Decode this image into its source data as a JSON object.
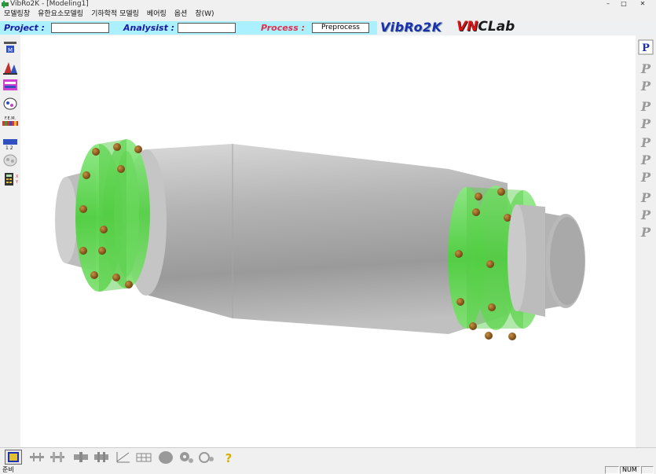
{
  "window": {
    "title": "VibRo2K - [Modeling1]"
  },
  "menu": [
    "모델링창",
    "유한요소모델링",
    "기하학적 모델링",
    "베어링",
    "옵션",
    "창(W)"
  ],
  "info": {
    "project_label": "Project :",
    "project_value": "",
    "analysist_label": "Analysist :",
    "analysist_value": "",
    "process_label": "Process :",
    "process_value": "Preprocess",
    "brand_logo": "VibRo2K",
    "lab_logo_a": "VN",
    "lab_logo_b": "CLab"
  },
  "left_toolbar": [
    "shaft-model-icon",
    "geometry-icon",
    "rotor-section-icon",
    "disk-icon",
    "fem-icon",
    "node-numbering-icon",
    "bearing-icon",
    "calculator-icon"
  ],
  "right_toolbar": [
    "process-p-icon",
    "p-icon-1",
    "p-icon-2",
    "p-icon-3",
    "p-icon-4",
    "p-icon-5",
    "p-icon-6",
    "p-icon-7",
    "p-icon-8",
    "p-icon-9",
    "p-icon-10"
  ],
  "bottom_toolbar": [
    "modeling-window-icon",
    "shaft-element-icon",
    "shaft-split-icon",
    "coupling-icon",
    "coupling-2-icon",
    "graph-icon",
    "fem-mesh-icon",
    "disk-shape-icon",
    "gear-icon",
    "gear-2-icon",
    "help-icon"
  ],
  "status": {
    "ready": "준비",
    "num": "NUM"
  },
  "colors": {
    "flange": "#5fd84f",
    "shaft": "#a8a8a8",
    "bolt": "#8a5a1a",
    "cyan_bar": "#aaf0ff"
  }
}
